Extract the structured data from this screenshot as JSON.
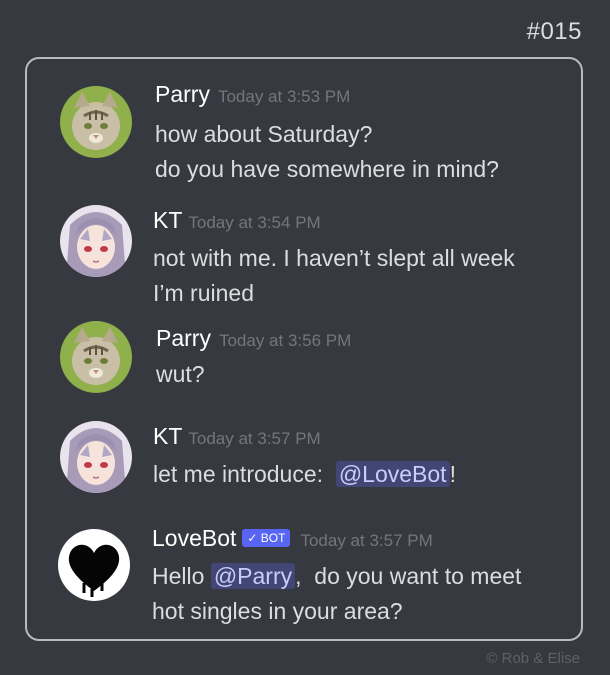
{
  "comic_id": "#015",
  "credit": "©  Rob & Elise",
  "messages": [
    {
      "author": "Parry",
      "time": "Today at 3:53 PM",
      "lines": [
        "how about Saturday?",
        "do you have somewhere in mind?"
      ]
    },
    {
      "author": "KT",
      "time": "Today at 3:54 PM",
      "lines": [
        "not with me. I haven’t slept all week",
        "I’m ruined"
      ]
    },
    {
      "author": "Parry",
      "time": "Today at 3:56 PM",
      "lines": [
        "wut?"
      ]
    },
    {
      "author": "KT",
      "time": "Today at 3:57 PM",
      "line_prefix": "let me introduce:  ",
      "mention": "@LoveBot",
      "line_suffix": "!"
    },
    {
      "author": "LoveBot",
      "bot_tag": "✓ BOT",
      "time": "Today at 3:57 PM",
      "line_prefix": "Hello ",
      "mention": "@Parry",
      "line_suffix": ",  do you want to meet",
      "line2": "hot singles in your area?"
    }
  ],
  "avatars": {
    "Parry": "cat-avatar",
    "KT": "anime-girl-avatar",
    "LoveBot": "black-heart-avatar"
  },
  "colors": {
    "background": "#36393f",
    "mention_bg": "#414675",
    "bot_tag": "#5865f2"
  }
}
